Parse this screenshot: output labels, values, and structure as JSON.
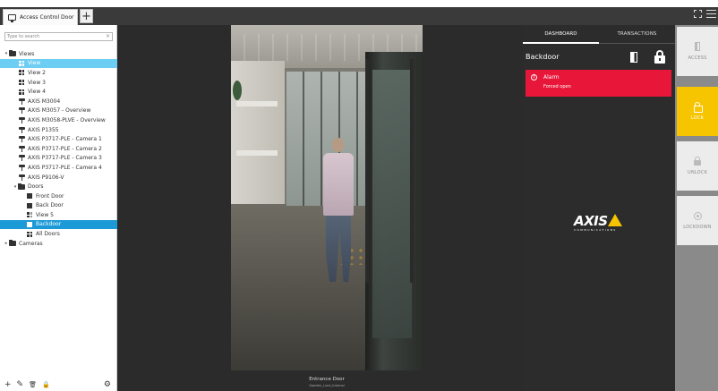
{
  "tab": {
    "title": "Access Control Door",
    "add_label": "+"
  },
  "search": {
    "placeholder": "Type to search",
    "clear": "×"
  },
  "tree": {
    "views_label": "Views",
    "views": [
      {
        "label": "View",
        "icon": "grid-view-icon",
        "state": "selected-light"
      },
      {
        "label": "View 2",
        "icon": "grid-view-icon"
      },
      {
        "label": "View 3",
        "icon": "grid-view-icon"
      },
      {
        "label": "View 4",
        "icon": "grid-view-icon"
      },
      {
        "label": "AXIS M3004",
        "icon": "camera-icon"
      },
      {
        "label": "AXIS M3057 - Overview",
        "icon": "camera-icon"
      },
      {
        "label": "AXIS M3058-PLVE - Overview",
        "icon": "camera-icon"
      },
      {
        "label": "AXIS P1355",
        "icon": "camera-icon"
      },
      {
        "label": "AXIS P3717-PLE - Camera 1",
        "icon": "camera-icon"
      },
      {
        "label": "AXIS P3717-PLE - Camera 2",
        "icon": "camera-icon"
      },
      {
        "label": "AXIS P3717-PLE - Camera 3",
        "icon": "camera-icon"
      },
      {
        "label": "AXIS P3717-PLE - Camera 4",
        "icon": "camera-icon"
      },
      {
        "label": "AXIS P9106-V",
        "icon": "camera-icon"
      }
    ],
    "doors_label": "Doors",
    "doors": [
      {
        "label": "Front Door",
        "icon": "door-icon"
      },
      {
        "label": "Back Door",
        "icon": "door-icon"
      },
      {
        "label": "View 5",
        "icon": "grid-view-icon"
      },
      {
        "label": "Backdoor",
        "icon": "door-icon",
        "state": "selected-dark"
      },
      {
        "label": "All Doors",
        "icon": "grid-view-icon"
      }
    ],
    "cameras_label": "Cameras"
  },
  "toolbar": {
    "add": "+",
    "edit": "✎",
    "delete": "🗑",
    "lock": "🔒",
    "settings": "⚙"
  },
  "video": {
    "camera_name": "Entrance Door",
    "camera_sub": "Sweden_Lund_Internal"
  },
  "dashboard": {
    "tabs": [
      "DASHBOARD",
      "TRANSACTIONS"
    ],
    "door_name": "Backdoor",
    "alarm": {
      "title": "Alarm",
      "detail": "Forced open",
      "icon": "!"
    },
    "logo_word": "AXIS",
    "logo_sub": "COMMUNICATIONS"
  },
  "actions": [
    {
      "label": "ACCESS",
      "icon": "door-open-icon"
    },
    {
      "label": "LOCK",
      "icon": "lock-icon",
      "active": true
    },
    {
      "label": "UNLOCK",
      "icon": "unlock-icon"
    },
    {
      "label": "LOCKDOWN",
      "icon": "lockdown-icon"
    }
  ],
  "colors": {
    "alarm": "#e8173a",
    "lock_active": "#f7c400",
    "selection": "#1c9ad8",
    "selection_light": "#6dcef3"
  }
}
